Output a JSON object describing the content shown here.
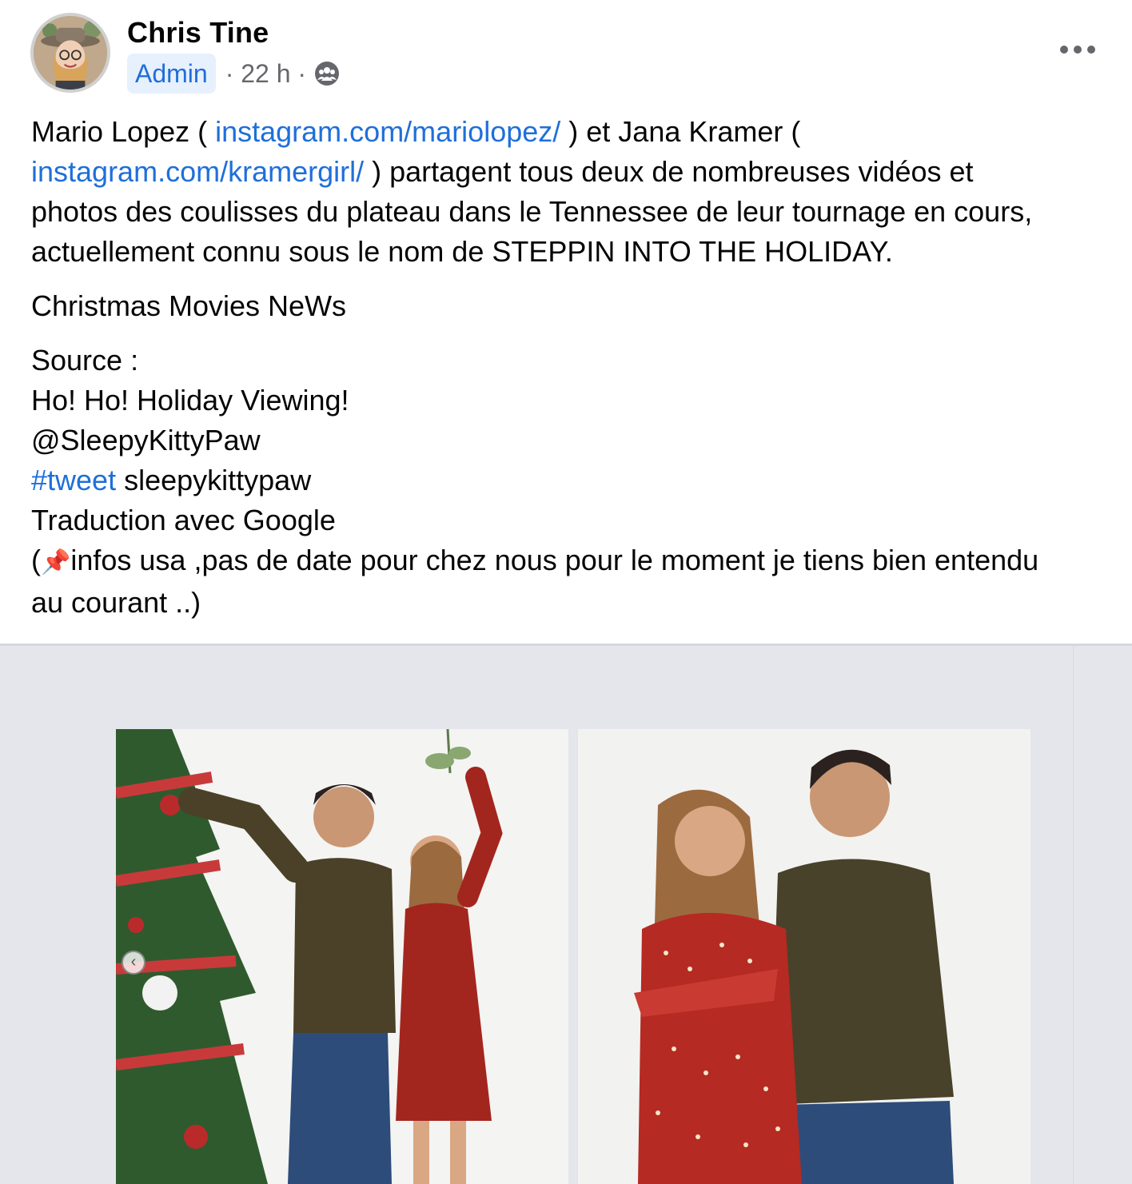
{
  "post": {
    "author": "Chris Tine",
    "badge": "Admin",
    "meta": "· 22 h ·",
    "privacy_icon": "group-icon",
    "more_icon": "more-options-icon"
  },
  "content": {
    "para1": {
      "t1": "Mario Lopez ( ",
      "link1": "instagram.com/mariolopez/",
      "t2": " ) et Jana Kramer (",
      "link2": "instagram.com/kramergirl/",
      "t3": " ) partagent tous deux de nombreuses vidéos et",
      "t4": "photos des coulisses du plateau dans le Tennessee de leur tournage en cours,",
      "t5": "actuellement connu sous le nom de STEPPIN INTO THE HOLIDAY."
    },
    "para2": "Christmas Movies NeWs",
    "para3": {
      "l1": "Source :",
      "l2": "Ho! Ho! Holiday Viewing!",
      "l3": "@SleepyKittyPaw",
      "hashtag": "#tweet",
      "l4_rest": " sleepykittypaw",
      "l5": "Traduction avec Google",
      "l6_open": "(",
      "pin": "📌",
      "l6_rest": "infos usa ,pas de date pour chez nous pour le moment je tiens bien entendu",
      "l7": "au courant ..)"
    }
  },
  "colors": {
    "link": "#1f6fd9",
    "badge_bg": "#e7f0fd",
    "meta": "#65676b",
    "media_bg": "#e4e6eb"
  },
  "media": {
    "prev_icon": "chevron-left-icon",
    "prev_glyph": "‹"
  }
}
